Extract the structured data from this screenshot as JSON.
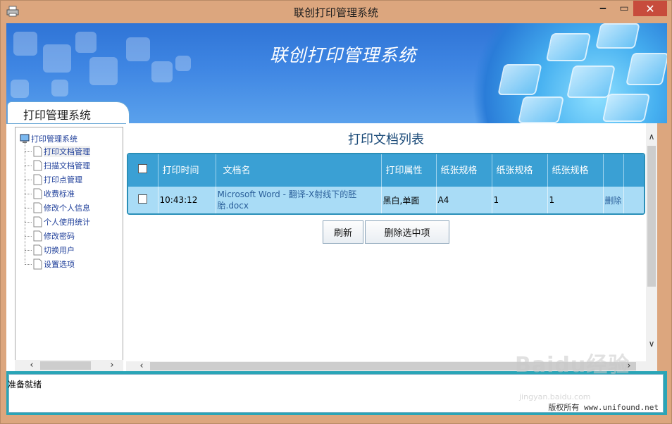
{
  "window": {
    "title": "联创打印管理系统",
    "minimize_glyph": "🗕",
    "maximize_glyph": "▭",
    "close_glyph": "✕"
  },
  "banner": {
    "title": "联创打印管理系统"
  },
  "tab": {
    "label": "打印管理系统"
  },
  "tree": {
    "root": "打印管理系统",
    "items": [
      "打印文档管理",
      "扫描文档管理",
      "打印点管理",
      "收费标准",
      "修改个人信息",
      "个人使用统计",
      "修改密码",
      "切换用户",
      "设置选项"
    ]
  },
  "list": {
    "title": "打印文档列表",
    "columns": [
      "打印时间",
      "文档名",
      "打印属性",
      "纸张规格",
      "纸张规格",
      "纸张规格"
    ],
    "rows": [
      {
        "time": "10:43:12",
        "name": "Microsoft Word - 翻译-X射线下的胚胎.docx",
        "attr": "黑白,单面",
        "paper": "A4",
        "c5": "1",
        "c6": "1",
        "action": "删除"
      }
    ]
  },
  "buttons": {
    "refresh": "刷新",
    "delete_selected": "删除选中项"
  },
  "status": {
    "text": "准备就绪",
    "copyright": "版权所有 www.unifound.net"
  },
  "watermark": {
    "main": "Baidu经验",
    "sub": "jingyan.baidu.com"
  },
  "colors": {
    "header": "#3aa0d4",
    "row": "#a9dcf6",
    "frame": "#dca67e",
    "close": "#c74c3c",
    "accent": "#2aa5b7"
  },
  "icons": {
    "app": "printer-icon",
    "tree_root": "computer-icon",
    "tree_item": "document-icon"
  }
}
